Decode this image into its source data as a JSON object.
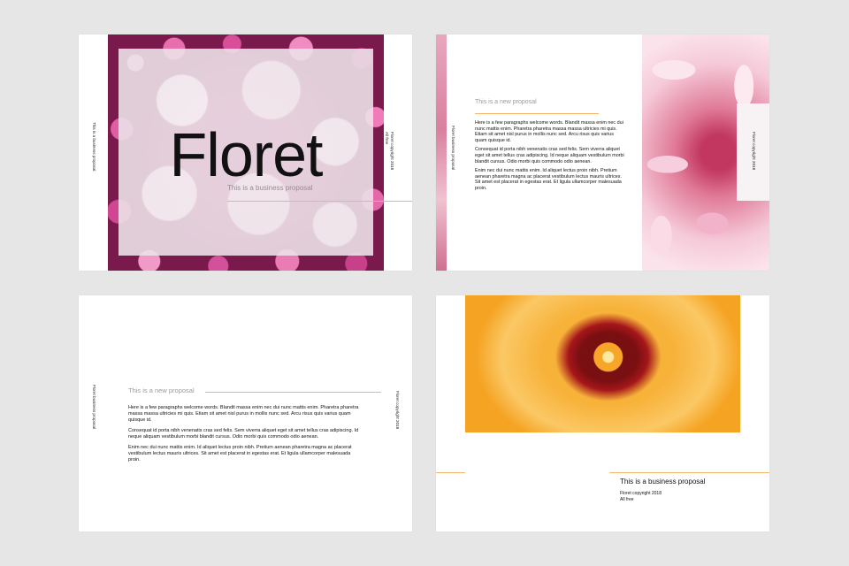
{
  "colors": {
    "background": "#e6e6e6",
    "accent_line": "#f3b36a",
    "slide": "#ffffff"
  },
  "slide1": {
    "title": "Floret",
    "subtitle": "This is a business proposal",
    "left_vertical": "This is a business proposal",
    "right_vertical_line1": "Floret copyright 2018",
    "right_vertical_line2": "All free"
  },
  "slide2": {
    "left_vertical": "Floret business proposal",
    "heading": "This is a new proposal",
    "paragraphs": [
      "Here is a few paragraphs welcome words. Blandit massa enim nec dui nunc mattis enim. Pharetra pharetra massa massa ultricies mi quis. Etiam sit amet nisl purus in mollis nunc sed. Arcu risus quis varius quam quisque id.",
      "Consequat id porta nibh venenatis cras sed felis. Sem viverra aliquet eget sit amet tellus cras adipiscing. Id neque aliquam vestibulum morbi blandit cursus. Odio morbi quis commodo odio aenean.",
      "Enim nec dui nunc mattis enim. Id aliquet lectus proin nibh. Pretium aenean pharetra magna ac placerat vestibulum lectus mauris ultrices. Sit amet est placerat in egestas erat. Et ligula ullamcorper malesuada proin."
    ],
    "right_vertical": "Floret copyright 2018"
  },
  "slide3": {
    "left_vertical": "Floret business proposal",
    "heading": "This is a new proposal",
    "paragraphs": [
      "Here is a few paragraphs welcome words. Blandit massa enim nec dui nunc mattis enim. Pharetra pharetra massa massa ultricies mi quis. Etiam sit amet nisl purus in mollis nunc sed. Arcu risus quis varius quam quisque id.",
      "Consequat id porta nibh venenatis cras sed felis. Sem viverra aliquet eget sit amet tellus cras adipiscing. Id neque aliquam vestibulum morbi blandit cursus. Odio morbi quis commodo odio aenean.",
      "Enim nec dui nunc mattis enim. Id aliquet lectus proin nibh. Pretium aenean pharetra magna ac placerat vestibulum lectus mauris ultrices. Sit amet est placerat in egestas erat. Et ligula ullamcorper malesuada proin."
    ],
    "right_vertical": "Floret copyright 2018"
  },
  "slide4": {
    "title": "This is a business proposal",
    "line1": "Floret copyright 2018",
    "line2": "All free"
  }
}
